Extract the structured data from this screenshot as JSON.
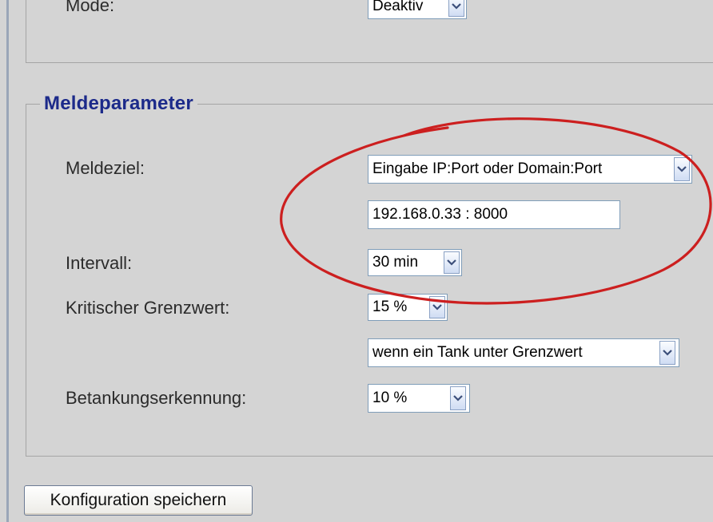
{
  "top_section": {
    "mode_label": "Mode:",
    "mode_value": "Deaktiv"
  },
  "melde": {
    "legend": "Meldeparameter",
    "meldeziel_label": "Meldeziel:",
    "meldeziel_value": "Eingabe IP:Port oder Domain:Port",
    "address_value": "192.168.0.33 : 8000",
    "intervall_label": "Intervall:",
    "intervall_value": "30 min",
    "grenzwert_label": "Kritischer Grenzwert:",
    "grenzwert_value": "15 %",
    "condition_value": "wenn ein Tank unter Grenzwert",
    "betankung_label": "Betankungserkennung:",
    "betankung_value": "10 %"
  },
  "save_button_label": "Konfiguration speichern",
  "colors": {
    "background": "#d4d4d4",
    "legend": "#1c2a8a",
    "annotation": "#cc1f1f"
  },
  "icons": {
    "dropdown": "chevron-down-icon",
    "annotation": "red-ellipse-annotation"
  }
}
